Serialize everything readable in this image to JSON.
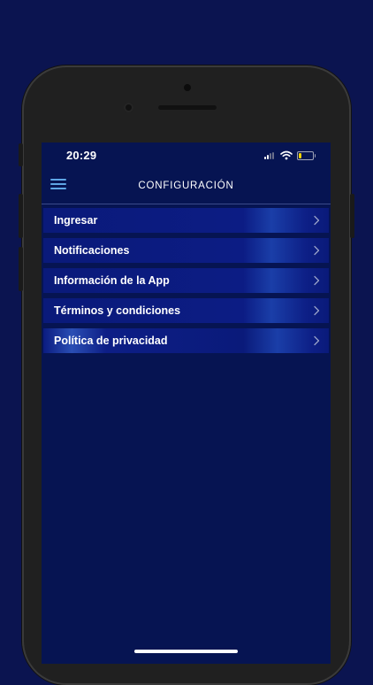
{
  "status_bar": {
    "time": "20:29"
  },
  "nav": {
    "title": "CONFIGURACIÓN"
  },
  "menu": {
    "items": [
      {
        "label": "Ingresar"
      },
      {
        "label": "Notificaciones"
      },
      {
        "label": "Información de la App"
      },
      {
        "label": "Términos y condiciones"
      },
      {
        "label": "Política de privacidad"
      }
    ]
  },
  "colors": {
    "page_background": "#0b1450",
    "screen_background": "#061452",
    "menu_item": "#0a1a7a",
    "menu_icon": "#5ea6e6",
    "battery": "#f2d200"
  },
  "icons": {
    "menu": "hamburger-icon",
    "chevron": "chevron-right-icon",
    "wifi": "wifi-icon",
    "signal": "cellular-signal-icon",
    "battery": "battery-icon"
  }
}
